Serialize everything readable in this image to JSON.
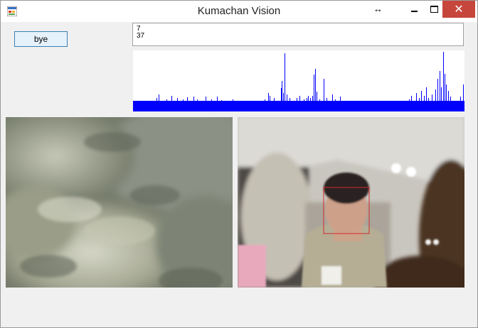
{
  "window": {
    "title": "Kumachan Vision",
    "controls": {
      "resize_glyph": "↔",
      "close_glyph": "✕"
    }
  },
  "bye_button": {
    "label": "bye"
  },
  "output": {
    "lines": [
      "7",
      "37"
    ]
  },
  "histogram": {
    "bar_color": "#0000ff",
    "baseline_fraction": 0.18,
    "spikes": [
      [
        33,
        0.22
      ],
      [
        36,
        0.28
      ],
      [
        38,
        0.18
      ],
      [
        44,
        0.18
      ],
      [
        47,
        0.2
      ],
      [
        50,
        0.16
      ],
      [
        54,
        0.25
      ],
      [
        58,
        0.18
      ],
      [
        62,
        0.22
      ],
      [
        66,
        0.16
      ],
      [
        70,
        0.2
      ],
      [
        76,
        0.23
      ],
      [
        80,
        0.18
      ],
      [
        85,
        0.24
      ],
      [
        90,
        0.2
      ],
      [
        96,
        0.18
      ],
      [
        102,
        0.24
      ],
      [
        110,
        0.2
      ],
      [
        118,
        0.24
      ],
      [
        124,
        0.19
      ],
      [
        131,
        0.16
      ],
      [
        140,
        0.2
      ],
      [
        147,
        0.18
      ],
      [
        153,
        0.16
      ],
      [
        168,
        0.18
      ],
      [
        176,
        0.16
      ],
      [
        185,
        0.2
      ],
      [
        190,
        0.3
      ],
      [
        192,
        0.26
      ],
      [
        198,
        0.22
      ],
      [
        206,
        0.18
      ],
      [
        208,
        0.38
      ],
      [
        209,
        0.5
      ],
      [
        211,
        0.3
      ],
      [
        213,
        0.95
      ],
      [
        216,
        0.28
      ],
      [
        220,
        0.22
      ],
      [
        225,
        0.18
      ],
      [
        230,
        0.22
      ],
      [
        234,
        0.26
      ],
      [
        240,
        0.2
      ],
      [
        244,
        0.22
      ],
      [
        246,
        0.25
      ],
      [
        249,
        0.22
      ],
      [
        252,
        0.26
      ],
      [
        254,
        0.6
      ],
      [
        256,
        0.7
      ],
      [
        258,
        0.32
      ],
      [
        262,
        0.2
      ],
      [
        268,
        0.54
      ],
      [
        272,
        0.22
      ],
      [
        276,
        0.18
      ],
      [
        280,
        0.28
      ],
      [
        284,
        0.2
      ],
      [
        291,
        0.24
      ],
      [
        360,
        0.16
      ],
      [
        388,
        0.2
      ],
      [
        391,
        0.26
      ],
      [
        395,
        0.18
      ],
      [
        398,
        0.3
      ],
      [
        402,
        0.22
      ],
      [
        405,
        0.34
      ],
      [
        409,
        0.26
      ],
      [
        412,
        0.4
      ],
      [
        415,
        0.22
      ],
      [
        420,
        0.28
      ],
      [
        425,
        0.36
      ],
      [
        428,
        0.54
      ],
      [
        431,
        0.66
      ],
      [
        433,
        0.4
      ],
      [
        436,
        0.98
      ],
      [
        438,
        0.62
      ],
      [
        440,
        0.44
      ],
      [
        443,
        0.34
      ],
      [
        446,
        0.24
      ],
      [
        452,
        0.18
      ],
      [
        460,
        0.24
      ],
      [
        464,
        0.44
      ]
    ]
  },
  "camera_left": {
    "name": "fur-closeup-feed"
  },
  "camera_right": {
    "name": "office-person-feed",
    "detection_box_color": "#d42a2a"
  }
}
